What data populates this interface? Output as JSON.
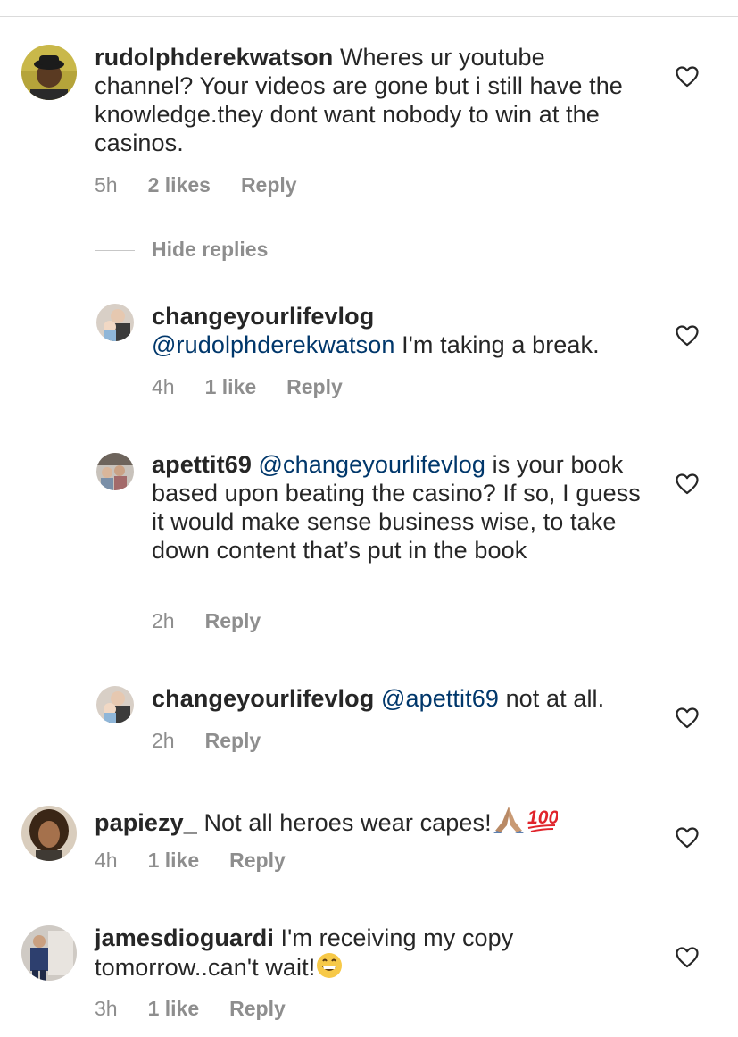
{
  "hide_replies": "Hide replies",
  "comments": [
    {
      "username": "rudolphderekwatson",
      "text": " Wheres ur youtube channel? Your videos are gone but i still have the knowledge.they dont want nobody to win at the casinos.",
      "time": "5h",
      "likes": "2 likes",
      "reply": "Reply"
    },
    {
      "username": "changeyourlifevlog",
      "mention": "@rudolphderekwatson",
      "text": " I'm taking a break.",
      "time": "4h",
      "likes": "1 like",
      "reply": "Reply"
    },
    {
      "username": "apettit69",
      "mention": "@changeyourlifevlog",
      "text": " is your book based upon beating the casino? If so, I guess it would make sense business wise, to take down content that’s put in the book",
      "time": "2h",
      "reply": "Reply"
    },
    {
      "username": "changeyourlifevlog",
      "mention": "@apettit69",
      "text": " not at all.",
      "time": "2h",
      "reply": "Reply"
    },
    {
      "username": "papiezy_",
      "text": " Not all heroes wear capes!",
      "emoji": [
        "folded-hands-emoji",
        "hundred-points-emoji"
      ],
      "time": "4h",
      "likes": "1 like",
      "reply": "Reply"
    },
    {
      "username": "jamesdioguardi",
      "text": " I'm receiving my copy tomorrow..can't wait!",
      "emoji": [
        "grinning-face-emoji"
      ],
      "time": "3h",
      "likes": "1 like",
      "reply": "Reply"
    }
  ]
}
